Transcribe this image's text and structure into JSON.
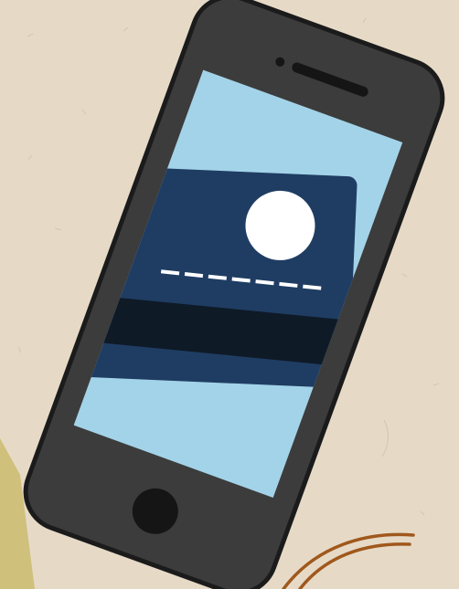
{
  "illustration": {
    "subject": "smartphone-showing-payment-card",
    "icons": [
      "phone-icon",
      "credit-card-icon",
      "home-button-icon",
      "speaker-icon"
    ]
  },
  "colors": {
    "background": "#e6dac7",
    "phone_body": "#3c3c3c",
    "phone_outline": "#1b1b1b",
    "screen": "#a3d3e8",
    "card": "#1f3d63",
    "card_stripe": "#0f1a27",
    "card_chip": "#f2b51f",
    "card_circle": "#ffffff",
    "card_dashes": "#ffffff",
    "olive_shape": "#cfc07b",
    "brown_curve": "#a0581c"
  }
}
